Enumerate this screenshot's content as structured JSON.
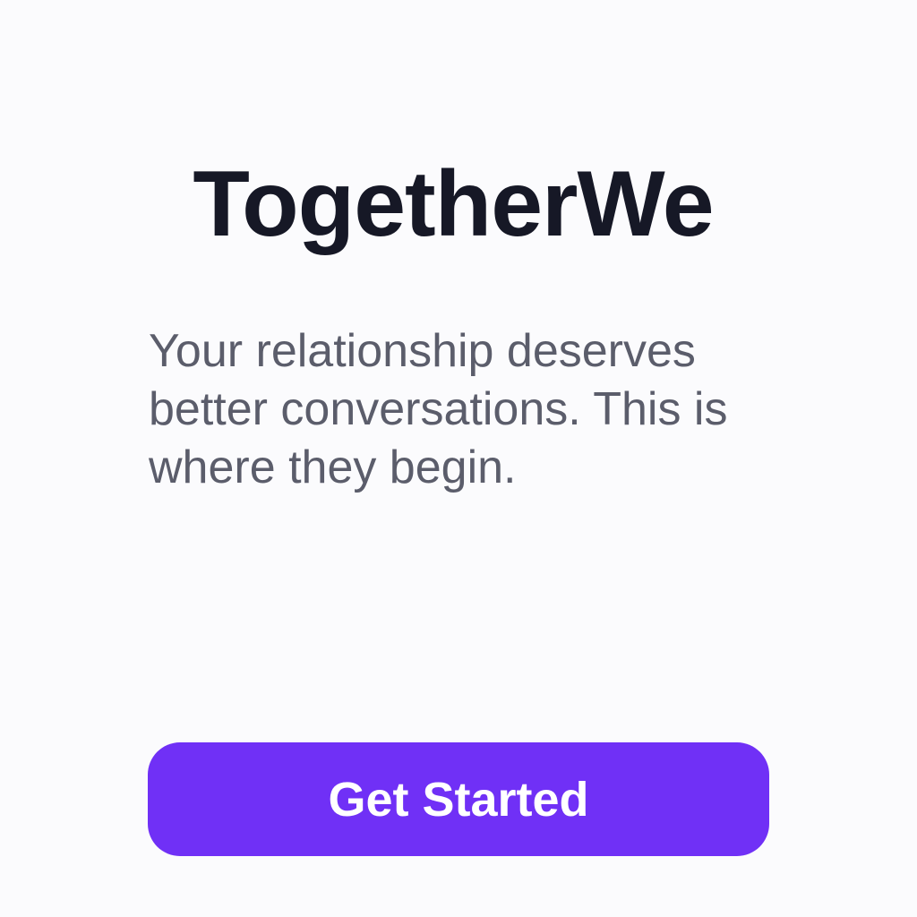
{
  "app": {
    "title": "TogetherWe"
  },
  "intro": {
    "tagline": "Your relationship deserves better conversations. This is where they begin."
  },
  "cta": {
    "label": "Get Started"
  },
  "colors": {
    "background": "#fbfbfd",
    "title": "#161826",
    "tagline": "#5b5d6b",
    "accent": "#7030f6",
    "button_text": "#ffffff"
  }
}
